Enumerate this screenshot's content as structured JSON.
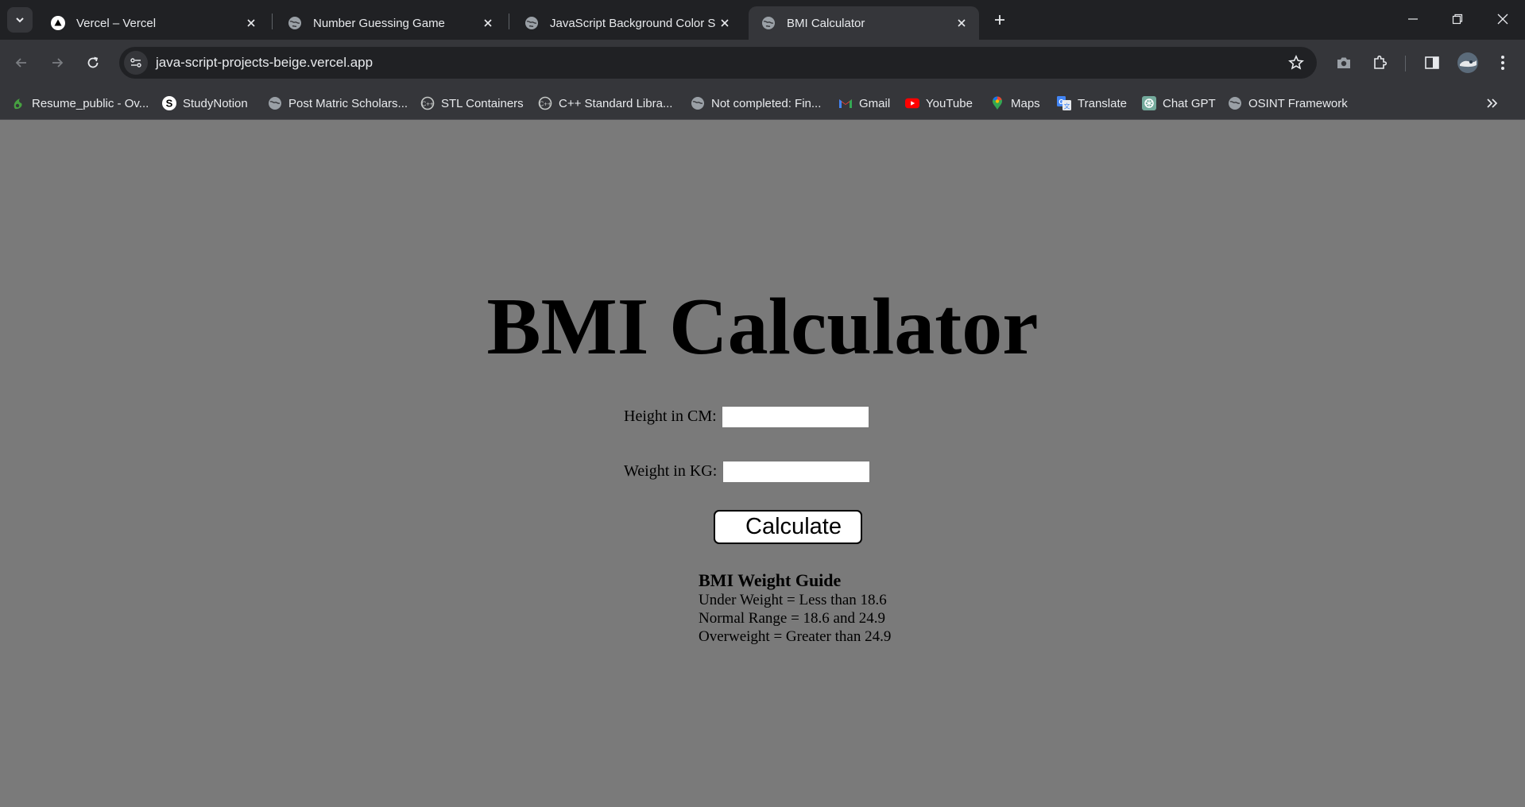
{
  "browser": {
    "tabs": [
      {
        "title": "Vercel – Vercel",
        "icon": "vercel-icon",
        "active": false
      },
      {
        "title": "Number Guessing Game",
        "icon": "globe-icon",
        "active": false
      },
      {
        "title": "JavaScript Background Color Sw",
        "icon": "globe-icon",
        "active": false
      },
      {
        "title": "BMI Calculator",
        "icon": "globe-icon",
        "active": true
      }
    ],
    "url": "java-script-projects-beige.vercel.app",
    "bookmarks": [
      {
        "label": "Resume_public - Ov...",
        "icon": "overleaf-icon"
      },
      {
        "label": "StudyNotion",
        "icon": "studynotion-icon"
      },
      {
        "label": "Post Matric Scholars...",
        "icon": "globe-icon"
      },
      {
        "label": "STL Containers",
        "icon": "cplusplus-icon"
      },
      {
        "label": "C++ Standard Libra...",
        "icon": "cplusplus-icon"
      },
      {
        "label": "Not completed: Fin...",
        "icon": "globe-icon"
      },
      {
        "label": "Gmail",
        "icon": "gmail-icon"
      },
      {
        "label": "YouTube",
        "icon": "youtube-icon"
      },
      {
        "label": "Maps",
        "icon": "maps-icon"
      },
      {
        "label": "Translate",
        "icon": "translate-icon"
      },
      {
        "label": "Chat GPT",
        "icon": "chatgpt-icon"
      },
      {
        "label": "OSINT Framework",
        "icon": "globe-icon"
      }
    ],
    "colors": {
      "chrome_dark": "#202124",
      "chrome_toolbar": "#35363a",
      "chrome_text": "#e8eaed"
    }
  },
  "page": {
    "title": "BMI Calculator",
    "background": "#7a7a7a",
    "height_label": "Height in CM:",
    "height_value": "",
    "weight_label": "Weight in KG:",
    "weight_value": "",
    "calculate_label": "Calculate",
    "guide": {
      "title": "BMI Weight Guide",
      "lines": [
        "Under Weight = Less than 18.6",
        "Normal Range = 18.6 and 24.9",
        "Overweight = Greater than 24.9"
      ]
    }
  }
}
